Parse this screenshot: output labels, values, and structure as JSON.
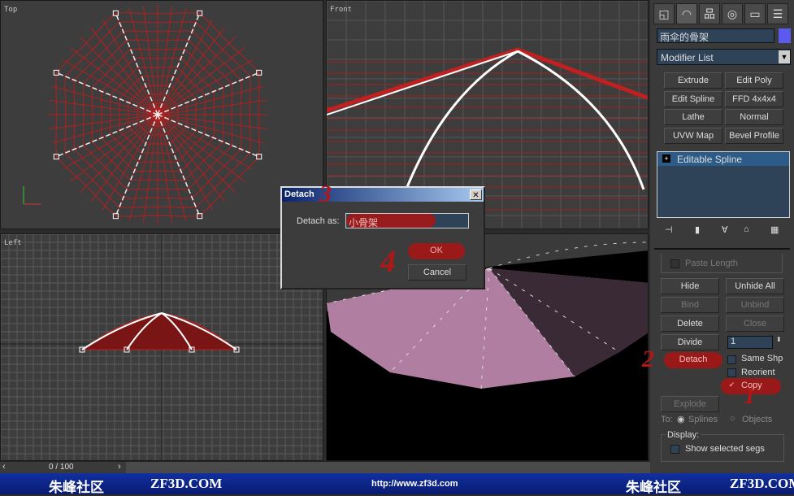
{
  "viewports": {
    "top": "Top",
    "front": "Front",
    "left": "Left",
    "perspective": ""
  },
  "panel": {
    "object_name": "雨伞的骨架",
    "object_color": "#5a5aee",
    "modifier_list": "Modifier List",
    "modifier_buttons": [
      "Extrude",
      "Edit Poly",
      "Edit Spline",
      "FFD 4x4x4",
      "Lathe",
      "Normal",
      "UVW Map",
      "Bevel Profile"
    ],
    "stack_item": "Editable Spline",
    "paste_length": "Paste Length",
    "buttons": {
      "hide": "Hide",
      "unhide_all": "Unhide All",
      "bind": "Bind",
      "unbind": "Unbind",
      "delete": "Delete",
      "close": "Close",
      "divide": "Divide",
      "divide_value": "1",
      "detach": "Detach",
      "explode": "Explode"
    },
    "checks": {
      "same_shp": "Same Shp",
      "reorient": "Reorient",
      "copy": "Copy",
      "copy_checked": true
    },
    "to_label": "To:",
    "splines": "Splines",
    "objects": "Objects",
    "display": "Display:",
    "show_selected_segs": "Show selected segs"
  },
  "dialog": {
    "title": "Detach",
    "label": "Detach as:",
    "value": "小骨架",
    "ok": "OK",
    "cancel": "Cancel"
  },
  "annotations": [
    "1",
    "2",
    "3",
    "4"
  ],
  "timeline": {
    "frame": "0 / 100"
  },
  "banner": {
    "logo": "朱峰社区",
    "site": "ZF3D.COM",
    "url": "http://www.zf3d.com"
  }
}
